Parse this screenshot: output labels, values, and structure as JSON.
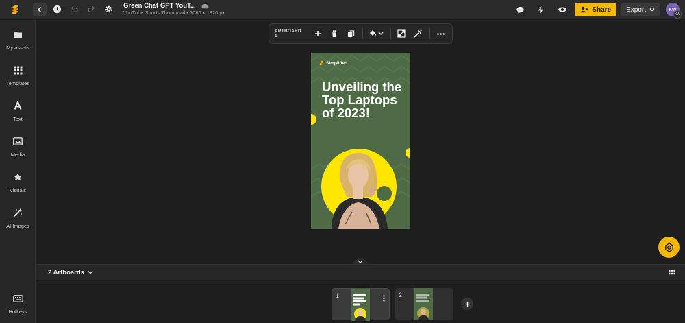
{
  "topbar": {
    "doc_title": "Green Chat GPT YouT...",
    "doc_subtitle": "YouTube Shorts Thumbnail • 1080 x 1920 px",
    "share_label": "Share",
    "export_label": "Export",
    "avatar_initials": "KW",
    "avatar_badge": "KW"
  },
  "sidebar": {
    "items": [
      {
        "label": "My assets",
        "icon": "folder-icon"
      },
      {
        "label": "Templates",
        "icon": "grid-icon"
      },
      {
        "label": "Text",
        "icon": "text-icon"
      },
      {
        "label": "Media",
        "icon": "image-icon"
      },
      {
        "label": "Visuals",
        "icon": "shapes-icon"
      },
      {
        "label": "AI Images",
        "icon": "magic-wand-icon"
      }
    ],
    "hotkeys_label": "Hotkeys"
  },
  "floatbar": {
    "artboard_label": "ARTBOARD 1"
  },
  "artboard": {
    "brand": "Simplified",
    "headline": "Unveiling the Top Laptops of 2023!"
  },
  "bottom": {
    "artboards_label": "2 Artboards",
    "thumbs": [
      {
        "number": "1"
      },
      {
        "number": "2"
      }
    ]
  },
  "colors": {
    "accent": "#f5b800",
    "artboard_green": "#4e6b45",
    "yellow_shape": "#ffe600"
  }
}
